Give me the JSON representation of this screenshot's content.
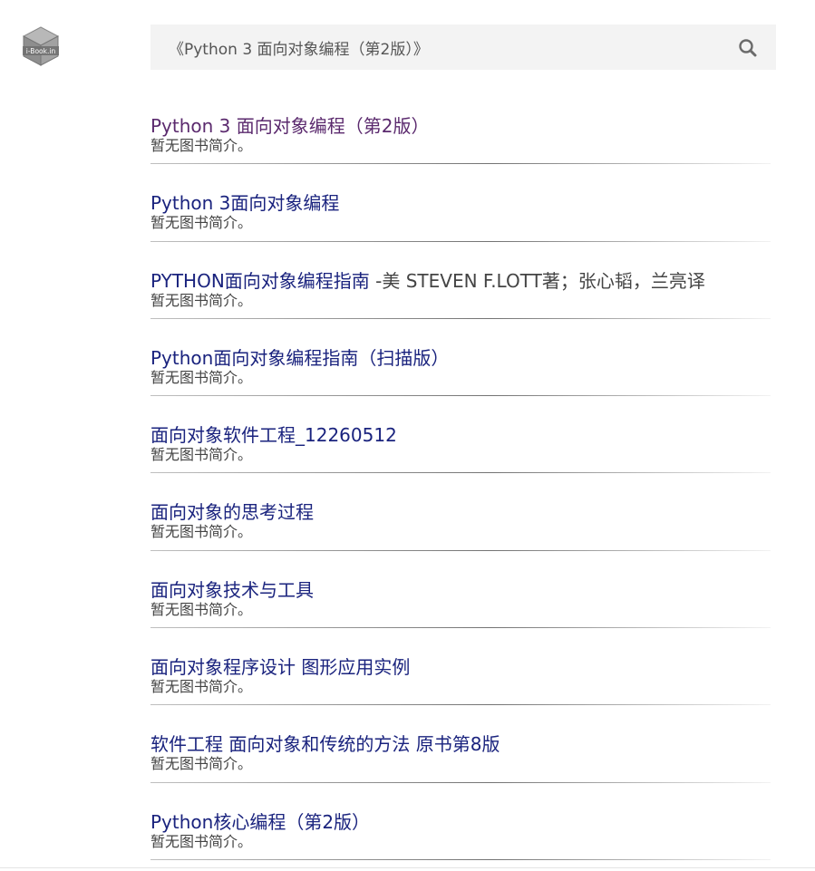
{
  "header": {
    "logo_icon": "cube-logo-icon",
    "logo_text": "i-Book.in",
    "search": {
      "value": "《Python 3 面向对象编程（第2版）》",
      "placeholder": "",
      "button_icon": "search-icon"
    }
  },
  "colors": {
    "link": "#1a237e",
    "visited_link": "#5b2a6e",
    "desc_text": "#444444",
    "search_bg": "#f3f3f3"
  },
  "results": [
    {
      "title": "Python 3 面向对象编程（第2版）",
      "author": "",
      "desc": "暂无图书简介。",
      "visited": true
    },
    {
      "title": "Python 3面向对象编程",
      "author": "",
      "desc": "暂无图书简介。",
      "visited": false
    },
    {
      "title": "PYTHON面向对象编程指南",
      "author": " -美 STEVEN F.LOTT著；张心韬，兰亮译",
      "desc": "暂无图书简介。",
      "visited": false
    },
    {
      "title": "Python面向对象编程指南（扫描版）",
      "author": "",
      "desc": "暂无图书简介。",
      "visited": false
    },
    {
      "title": "面向对象软件工程_12260512",
      "author": "",
      "desc": "暂无图书简介。",
      "visited": false
    },
    {
      "title": "面向对象的思考过程",
      "author": "",
      "desc": "暂无图书简介。",
      "visited": false
    },
    {
      "title": "面向对象技术与工具",
      "author": "",
      "desc": "暂无图书简介。",
      "visited": false
    },
    {
      "title": "面向对象程序设计 图形应用实例",
      "author": "",
      "desc": "暂无图书简介。",
      "visited": false
    },
    {
      "title": "软件工程 面向对象和传统的方法 原书第8版",
      "author": "",
      "desc": "暂无图书简介。",
      "visited": false
    },
    {
      "title": "Python核心编程（第2版）",
      "author": "",
      "desc": "暂无图书简介。",
      "visited": false
    }
  ]
}
